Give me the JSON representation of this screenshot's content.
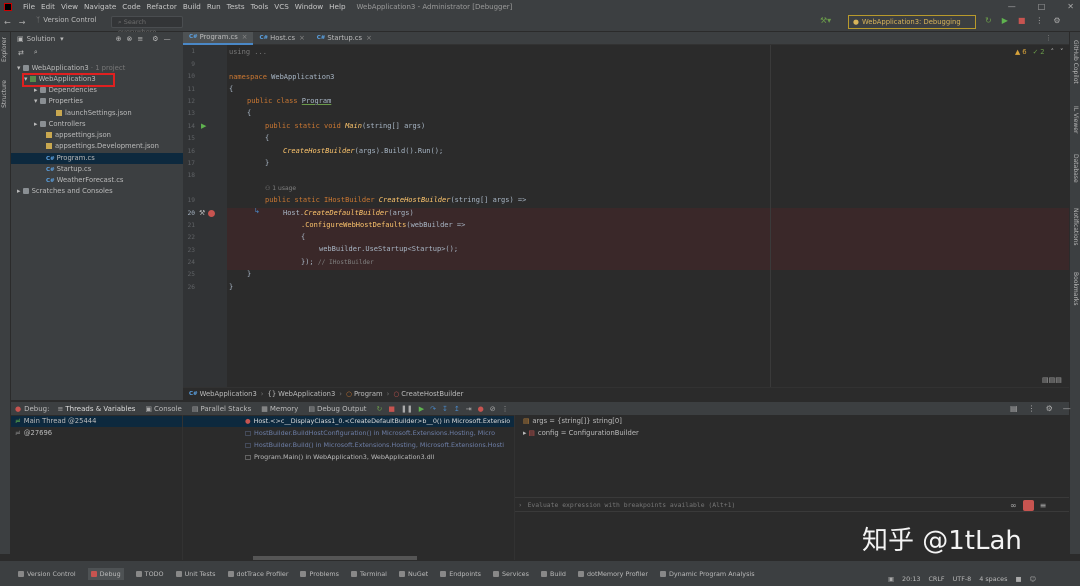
{
  "menu": {
    "items": [
      "File",
      "Edit",
      "View",
      "Navigate",
      "Code",
      "Refactor",
      "Build",
      "Run",
      "Tests",
      "Tools",
      "VCS",
      "Window",
      "Help"
    ],
    "title": "WebApplication3 - Administrator [Debugger]"
  },
  "toolbar": {
    "vcs": "Version Control",
    "search_placeholder": "Search everywhere",
    "run_config": "WebApplication3: Debugging"
  },
  "left_strip": {
    "explorer": "Explorer",
    "structure": "Structure"
  },
  "right_strip": {
    "copilot": "GitHub Copilot",
    "il_viewer": "IL Viewer",
    "database": "Database",
    "notifications": "Notifications",
    "bookmarks": "Bookmarks"
  },
  "explorer": {
    "header": "Solution",
    "items": [
      {
        "label": "WebApplication3",
        "meta": "· 1 project"
      },
      {
        "label": "WebApplication3"
      },
      {
        "label": "Dependencies"
      },
      {
        "label": "Properties"
      },
      {
        "label": "launchSettings.json"
      },
      {
        "label": "Controllers"
      },
      {
        "label": "appsettings.json"
      },
      {
        "label": "appsettings.Development.json"
      },
      {
        "label": "Program.cs"
      },
      {
        "label": "Startup.cs"
      },
      {
        "label": "WeatherForecast.cs"
      },
      {
        "label": "Scratches and Consoles"
      }
    ]
  },
  "tabs": [
    {
      "label": "Program.cs"
    },
    {
      "label": "Host.cs"
    },
    {
      "label": "Startup.cs"
    }
  ],
  "inspections": {
    "warnings": "6",
    "ok": "2"
  },
  "code": {
    "using": "using ...",
    "ns": "namespace WebApplication3",
    "brace_open": "{",
    "brace_close": "}",
    "class_kw": "public class",
    "class_name": "Program",
    "main_kw": "public static void",
    "main_name": "Main",
    "main_args": "(string[] args)",
    "create_call": "CreateHostBuilder",
    "create_rest": "(args).Build().Run();",
    "usage": "1 usage",
    "chb_kw": "public static IHostBuilder",
    "chb_name": "CreateHostBuilder",
    "chb_args": "(string[] args) =>",
    "host": "Host.",
    "cdb": "CreateDefaultBuilder",
    "cdb_args": "(args)",
    "cwhd": ".ConfigureWebHostDefaults",
    "cwhd_args": "(webBuilder =>",
    "usestartup": "webBuilder.UseStartup<Startup>();",
    "close_paren": "});",
    "hint": "// IHostBuilder",
    "lines": [
      "1",
      "9",
      "10",
      "11",
      "12",
      "13",
      "14",
      "15",
      "16",
      "17",
      "18",
      "19",
      "20",
      "21",
      "22",
      "23",
      "24",
      "25",
      "26"
    ]
  },
  "breadcrumb": [
    "WebApplication3",
    "WebApplication3",
    "Program",
    "CreateHostBuilder"
  ],
  "debug": {
    "label": "Debug:",
    "tabs": [
      "Threads & Variables",
      "Console",
      "Parallel Stacks",
      "Memory",
      "Debug Output"
    ]
  },
  "threads": [
    {
      "label": "Main Thread @25444"
    },
    {
      "label": "@27696"
    }
  ],
  "frames": [
    {
      "label": "Host.<>c__DisplayClass1_0.<CreateDefaultBuilder>b__0() in Microsoft.Extensio"
    },
    {
      "label": "HostBuilder.BuildHostConfiguration() in Microsoft.Extensions.Hosting, Micro"
    },
    {
      "label": "HostBuilder.Build() in Microsoft.Extensions.Hosting, Microsoft.Extensions.Hosti"
    },
    {
      "label": "Program.Main() in WebApplication3, WebApplication3.dll"
    }
  ],
  "variables": [
    {
      "label": "args = {string[]} string[0]"
    },
    {
      "label": "config = ConfigurationBuilder"
    }
  ],
  "eval_placeholder": "Evaluate expression with breakpoints available (Alt+1)",
  "statusbar": {
    "items": [
      "Version Control",
      "Debug",
      "TODO",
      "Unit Tests",
      "dotTrace Profiler",
      "Problems",
      "Terminal",
      "NuGet",
      "Endpoints",
      "Services",
      "Build",
      "dotMemory Profiler",
      "Dynamic Program Analysis"
    ],
    "right": [
      "20:13",
      "CRLF",
      "UTF-8",
      "4 spaces"
    ]
  },
  "watermark": "知乎 @1tLah",
  "colors": {
    "accent": "#4a88c7",
    "breakpoint": "#c75450",
    "highlight_box": "#e02020"
  }
}
